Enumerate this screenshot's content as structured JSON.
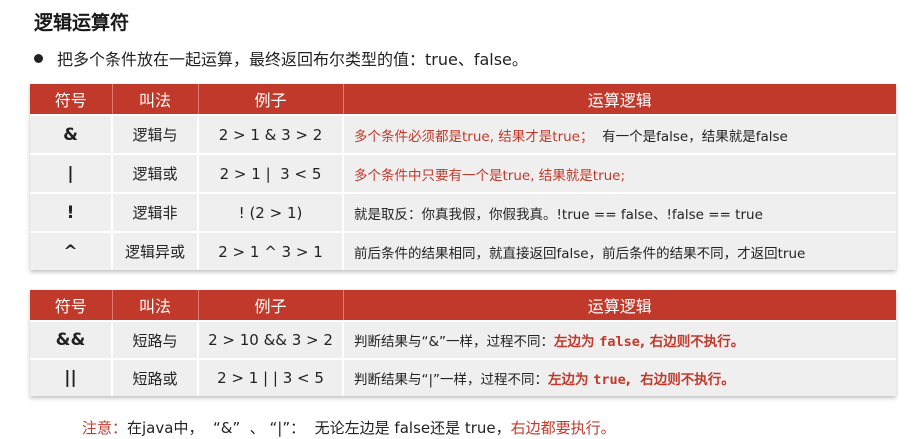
{
  "title": "逻辑运算符",
  "bullet": "把多个条件放在一起运算，最终返回布尔类型的值：true、false。",
  "headers": {
    "symbol": "符号",
    "name": "叫法",
    "example": "例子",
    "logic": "运算逻辑"
  },
  "table1": [
    {
      "symbol": "&",
      "name": "逻辑与",
      "example": "2 > 1 & 3 > 2",
      "logic_red": "多个条件必须都是true, 结果才是true；",
      "logic_plain": "  有一个是false，结果就是false"
    },
    {
      "symbol": "|",
      "name": "逻辑或",
      "example": "2 > 1 |  3 < 5",
      "logic_red": "多个条件中只要有一个是true, 结果就是true;",
      "logic_plain": ""
    },
    {
      "symbol": "!",
      "name": "逻辑非",
      "example": "! (2 > 1)",
      "logic_red": "",
      "logic_plain": "就是取反：你真我假，你假我真。!true == false、!false == true"
    },
    {
      "symbol": "^",
      "name": "逻辑异或",
      "example": "2 > 1 ^ 3 > 1",
      "logic_red": "",
      "logic_plain": "前后条件的结果相同，就直接返回false，前后条件的结果不同，才返回true"
    }
  ],
  "table2": [
    {
      "symbol": "&&",
      "name": "短路与",
      "example": "2 > 10 && 3 > 2",
      "logic_plain": "判断结果与“&”一样，过程不同：",
      "logic_red1": "左边为 ",
      "logic_code": "false",
      "logic_red2": ", 右边则不执行。"
    },
    {
      "symbol": "||",
      "name": "短路或",
      "example": "2 > 1 | | 3 < 5",
      "logic_plain": "判断结果与“|”一样，过程不同：",
      "logic_red1": "左边为 ",
      "logic_code": "true",
      "logic_red2": ",  右边则不执行。"
    }
  ],
  "note": {
    "label": "注意：",
    "text": "在java中，  “&”  、 “|”：  无论左边是 false还是 true，",
    "emphasis": "右边都要执行。"
  }
}
